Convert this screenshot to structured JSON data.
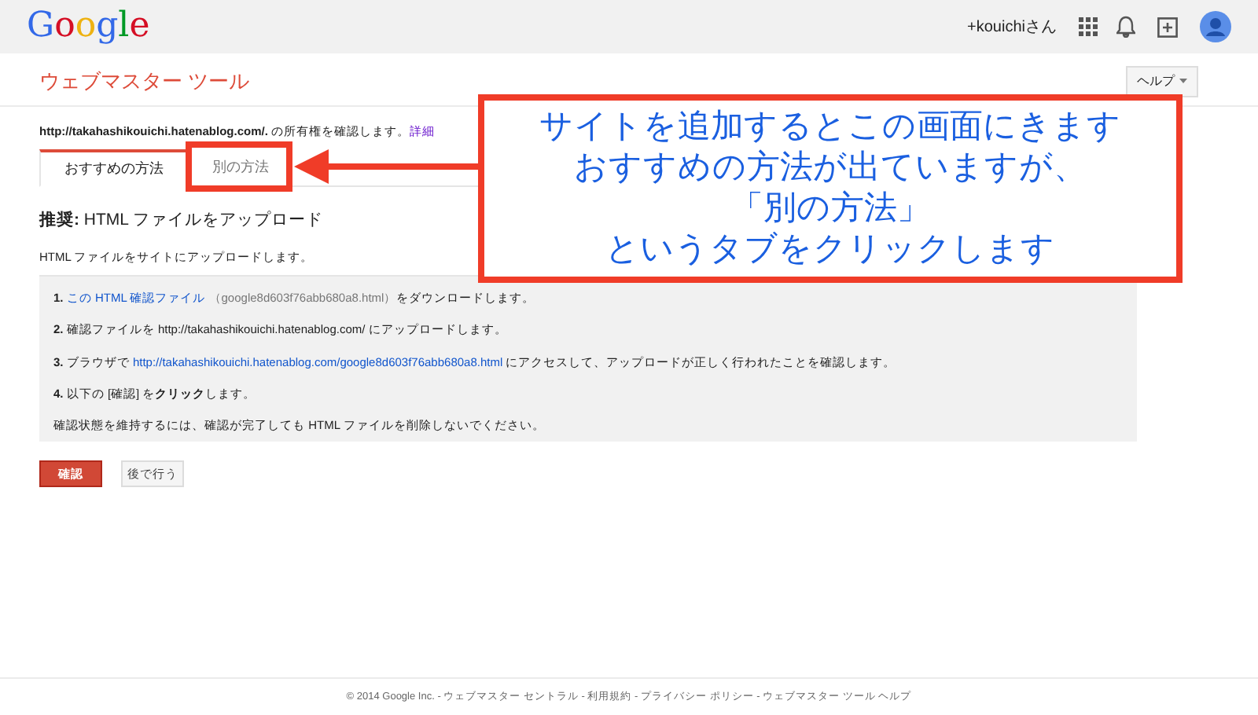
{
  "header": {
    "logo": "Google",
    "user": "+kouichiさん"
  },
  "app_title": "ウェブマスター ツール",
  "help_button": "ヘルプ",
  "ownership": {
    "url": "http://takahashikouichi.hatenablog.com/.",
    "text": "の所有権を確認します。",
    "link": "詳細"
  },
  "tabs": [
    {
      "label": "おすすめの方法",
      "selected": true
    },
    {
      "label": "別の方法",
      "selected": false
    }
  ],
  "heading": "**推奨:** HTML ファイルをアップロード",
  "description": "HTML ファイルをサイトにアップロードします。",
  "steps": [
    {
      "number": "1.",
      "parts": [
        {
          "kind": "link",
          "text": "この HTML 確認ファイル"
        },
        {
          "kind": "muted",
          "text": "（google8d603f76abb680a8.html）"
        },
        {
          "kind": "plain",
          "text": "をダウンロードします。"
        }
      ]
    },
    {
      "number": "2.",
      "parts": [
        {
          "kind": "plain",
          "text": "確認ファイルを http://takahashikouichi.hatenablog.com/ にアップロードします。"
        }
      ]
    },
    {
      "number": "3.",
      "parts": [
        {
          "kind": "plain",
          "text": "ブラウザで"
        },
        {
          "kind": "link",
          "text": "http://takahashikouichi.hatenablog.com/google8d603f76abb680a8.html"
        },
        {
          "kind": "plain",
          "text": "にアクセスして、アップロードが正しく行われたことを確認します。"
        }
      ]
    },
    {
      "number": "4.",
      "parts": [
        {
          "kind": "plain",
          "text": "以下の [確認] を**クリック**します。"
        }
      ]
    }
  ],
  "note": "確認状態を維持するには、確認が完了しても HTML ファイルを削除しないでください。",
  "buttons": [
    {
      "label": "確認",
      "kind": "primary"
    },
    {
      "label": "後で行う",
      "kind": "secondary"
    }
  ],
  "footer": "© 2014 Google Inc. - ウェブマスター セントラル - 利用規約 - プライバシー ポリシー - ウェブマスター ツール ヘルプ",
  "annotation": {
    "lines": [
      "サイトを追加するとこの画面にきます",
      "おすすめの方法が出ていますが、",
      "「別の方法」",
      "というタブをクリックします"
    ]
  }
}
